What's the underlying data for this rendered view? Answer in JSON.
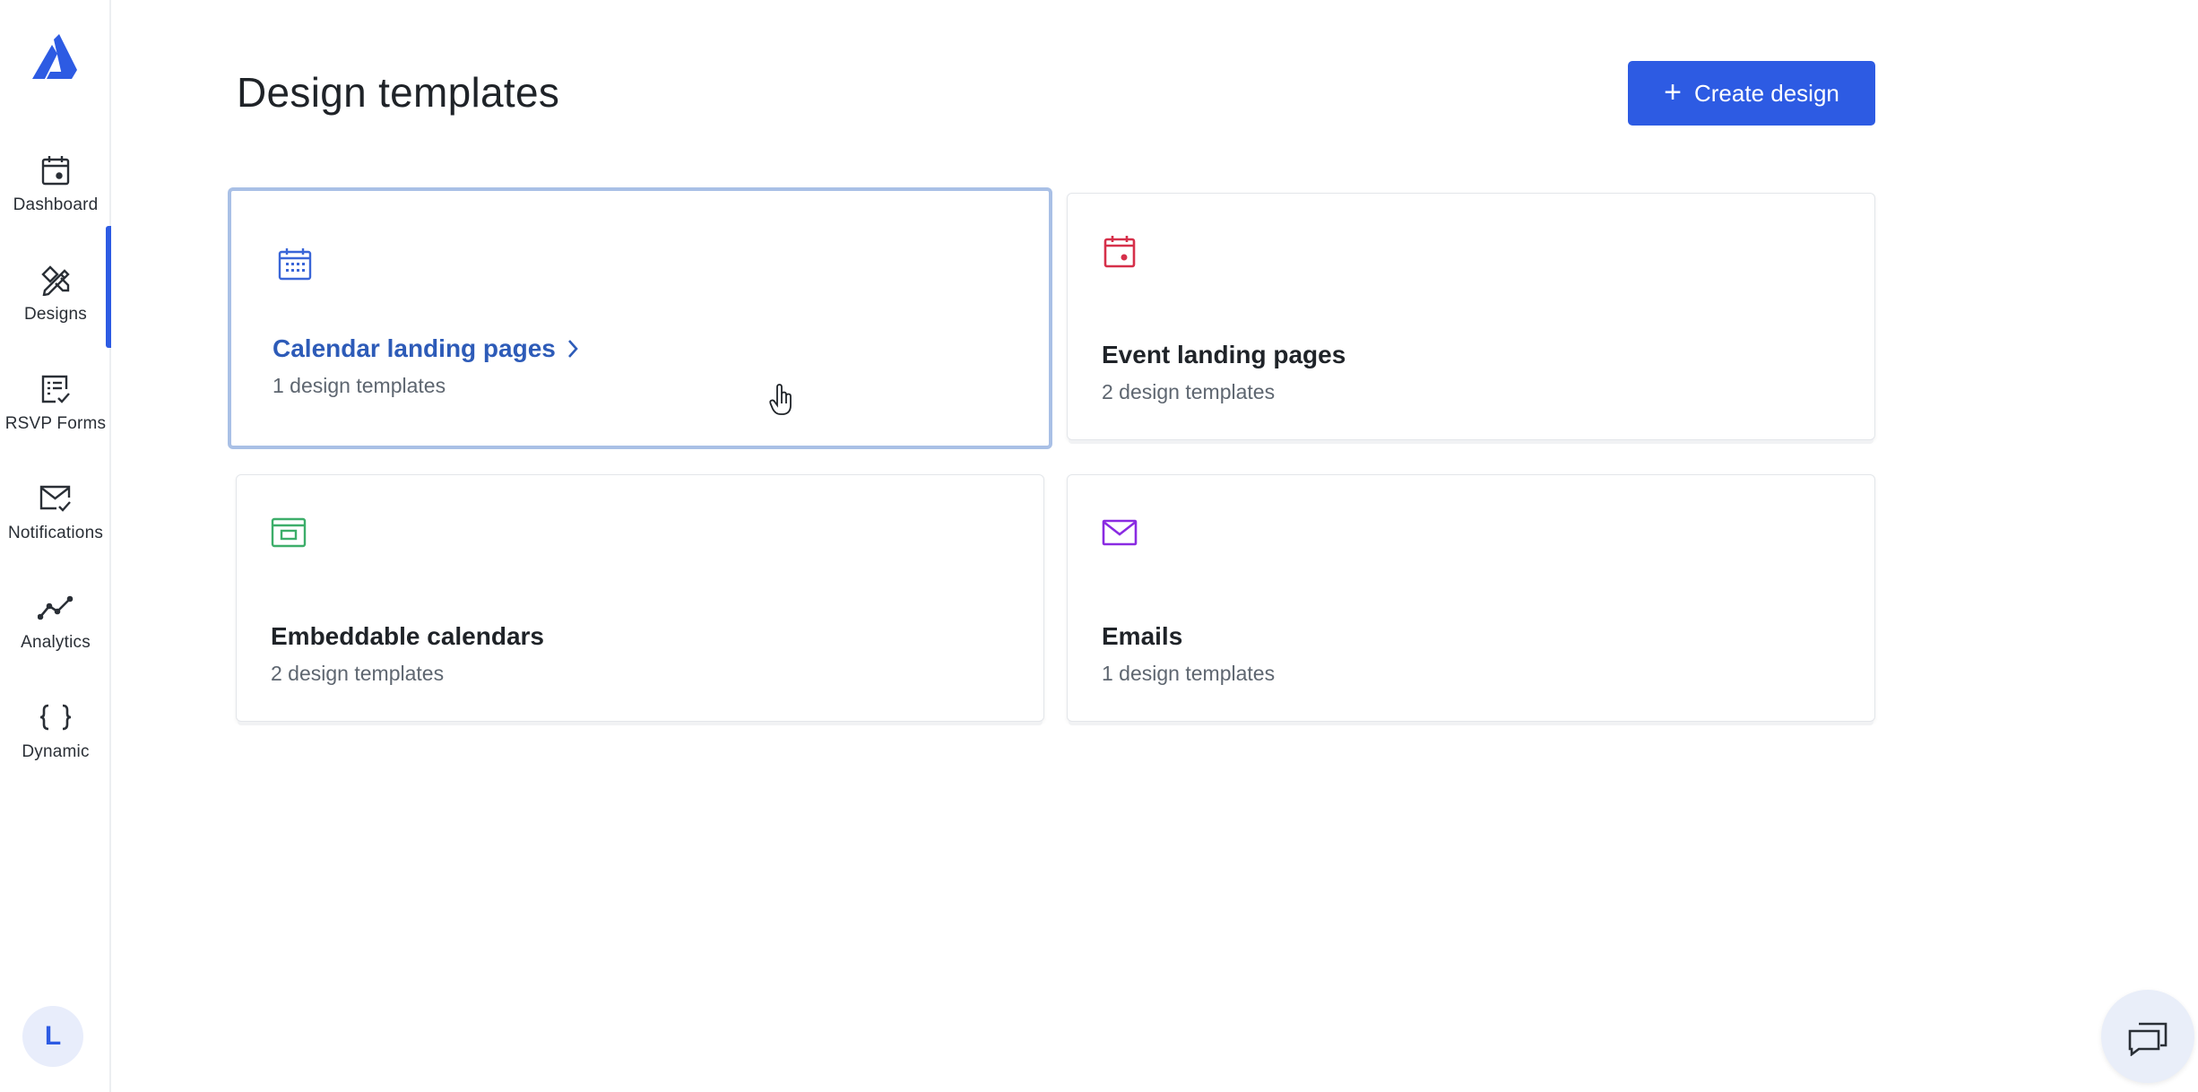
{
  "colors": {
    "accent": "#2d5be3",
    "accent_text": "#2d5bb8",
    "calendar_icon": "#3a66d8",
    "event_icon": "#d6304a",
    "embed_icon": "#3dae6a",
    "email_icon": "#8a2be2"
  },
  "sidebar": {
    "items": [
      {
        "label": "Dashboard",
        "icon": "calendar-dot-icon"
      },
      {
        "label": "Designs",
        "icon": "design-tools-icon",
        "active": true
      },
      {
        "label": "RSVP Forms",
        "icon": "form-check-icon"
      },
      {
        "label": "Notifications",
        "icon": "envelope-check-icon"
      },
      {
        "label": "Analytics",
        "icon": "line-chart-icon"
      },
      {
        "label": "Dynamic",
        "icon": "curly-braces-icon"
      }
    ],
    "avatar_initial": "L"
  },
  "header": {
    "title": "Design templates",
    "create_label": "Create design"
  },
  "cards": [
    {
      "title": "Calendar landing pages",
      "subtitle": "1 design templates",
      "icon": "calendar-grid-icon"
    },
    {
      "title": "Event landing pages",
      "subtitle": "2 design templates",
      "icon": "calendar-event-icon"
    },
    {
      "title": "Embeddable calendars",
      "subtitle": "2 design templates",
      "icon": "embed-window-icon"
    },
    {
      "title": "Emails",
      "subtitle": "1 design templates",
      "icon": "envelope-icon"
    }
  ]
}
